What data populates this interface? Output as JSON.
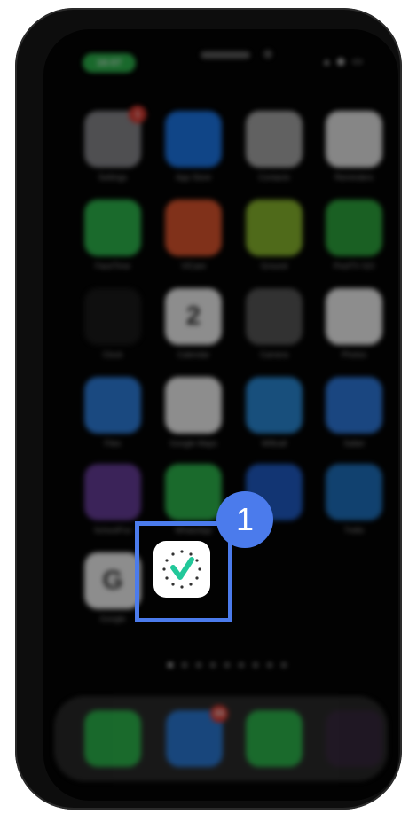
{
  "status_bar": {
    "time": "16:07",
    "icons": "▴ ◆ ▭"
  },
  "home_apps": [
    {
      "label": "Settings",
      "badge": "1",
      "color": "#8e8e93",
      "icon": "gear-icon"
    },
    {
      "label": "App Store",
      "color": "#1c7cf4",
      "icon": "app-store-icon"
    },
    {
      "label": "Contacts",
      "color": "#b0b0b0",
      "icon": "contacts-icon"
    },
    {
      "label": "Reminders",
      "color": "#f2f2f2",
      "icon": "reminders-icon"
    },
    {
      "label": "FaceTime",
      "color": "#2fbf50",
      "icon": "facetime-icon"
    },
    {
      "label": "VICare",
      "color": "#e8582e",
      "icon": "vicare-icon"
    },
    {
      "label": "Ground",
      "color": "#8fbf2e",
      "icon": "ground-icon"
    },
    {
      "label": "PostTV GO",
      "color": "#2fae3f",
      "icon": "posttv-icon"
    },
    {
      "label": "Clock",
      "color": "#1a1a1a",
      "icon": "clock-icon"
    },
    {
      "label": "Calendar",
      "color": "#ffffff",
      "icon": "calendar-icon",
      "text": "2"
    },
    {
      "label": "Camera",
      "color": "#5a5a5a",
      "icon": "camera-icon"
    },
    {
      "label": "Photos",
      "color": "#ffffff",
      "icon": "photos-icon"
    },
    {
      "label": "Files",
      "color": "#2f84e8",
      "icon": "files-icon"
    },
    {
      "label": "Google Maps",
      "color": "#ffffff",
      "icon": "maps-pin-icon"
    },
    {
      "label": "Wificall",
      "color": "#2a8fe0",
      "icon": "wificall-icon"
    },
    {
      "label": "Safari",
      "color": "#2f7fe8",
      "icon": "safari-icon"
    },
    {
      "label": "SchoolFox",
      "color": "#6b3fa0",
      "icon": "schoolfox-icon"
    },
    {
      "label": "WhatsApp",
      "color": "#2fbf50",
      "icon": "whatsapp-icon"
    },
    {
      "label": "",
      "color": "#2060d0",
      "icon": "arrow-nav-icon"
    },
    {
      "label": "Trello",
      "color": "#1f76c8",
      "icon": "trello-icon"
    },
    {
      "label": "Google",
      "color": "#ffffff",
      "icon": "google-icon",
      "text": "G"
    }
  ],
  "highlighted_app": {
    "icon": "checkmark-badge-icon",
    "accent": "#22c89a"
  },
  "step_number": "1",
  "page_dots": 9,
  "dock": [
    {
      "color": "#2fbf50",
      "icon": "phone-icon"
    },
    {
      "color": "#2a7fe0",
      "icon": "mail-icon",
      "badge": "35"
    },
    {
      "color": "#2fbf50",
      "icon": "messages-icon"
    },
    {
      "color": "#3a2a40",
      "icon": "power-icon"
    }
  ],
  "colors": {
    "highlight": "#4b7bec",
    "screen_bg": "#020202"
  }
}
